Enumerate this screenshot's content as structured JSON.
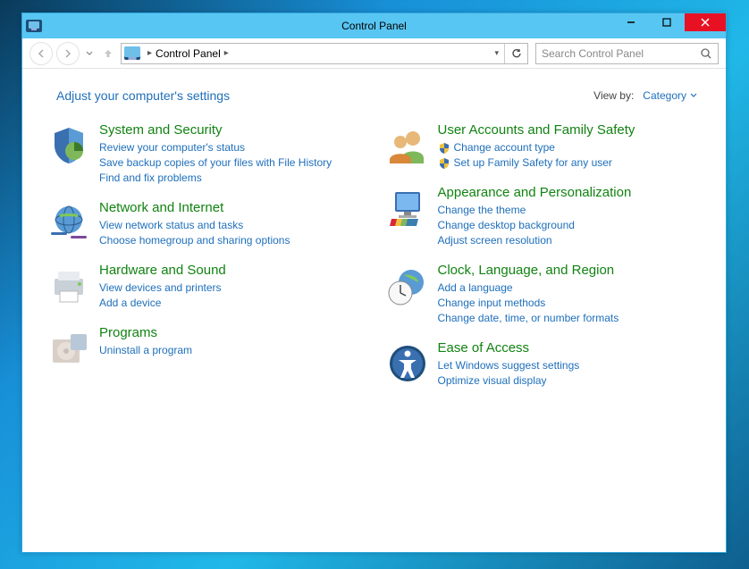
{
  "window": {
    "title": "Control Panel"
  },
  "toolbar": {
    "breadcrumb": "Control Panel",
    "search_placeholder": "Search Control Panel"
  },
  "header": {
    "title": "Adjust your computer's settings",
    "viewby_label": "View by:",
    "viewby_value": "Category"
  },
  "categories": {
    "system_security": {
      "title": "System and Security",
      "links": [
        "Review your computer's status",
        "Save backup copies of your files with File History",
        "Find and fix problems"
      ]
    },
    "network": {
      "title": "Network and Internet",
      "links": [
        "View network status and tasks",
        "Choose homegroup and sharing options"
      ]
    },
    "hardware": {
      "title": "Hardware and Sound",
      "links": [
        "View devices and printers",
        "Add a device"
      ]
    },
    "programs": {
      "title": "Programs",
      "links": [
        "Uninstall a program"
      ]
    },
    "users": {
      "title": "User Accounts and Family Safety",
      "links": [
        "Change account type",
        "Set up Family Safety for any user"
      ]
    },
    "appearance": {
      "title": "Appearance and Personalization",
      "links": [
        "Change the theme",
        "Change desktop background",
        "Adjust screen resolution"
      ]
    },
    "clock": {
      "title": "Clock, Language, and Region",
      "links": [
        "Add a language",
        "Change input methods",
        "Change date, time, or number formats"
      ]
    },
    "ease": {
      "title": "Ease of Access",
      "links": [
        "Let Windows suggest settings",
        "Optimize visual display"
      ]
    }
  }
}
